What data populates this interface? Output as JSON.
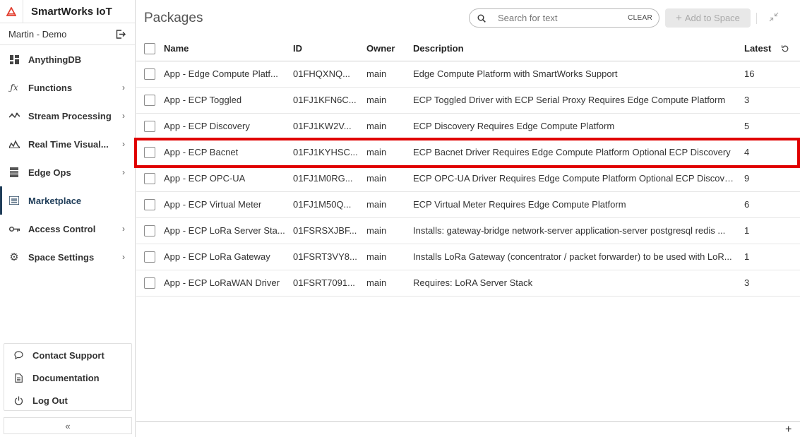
{
  "app": {
    "title": "SmartWorks IoT",
    "accent": "#e23c2d"
  },
  "user": {
    "name": "Martin - Demo"
  },
  "nav": [
    {
      "label": "AnythingDB",
      "icon": "dashboard-icon",
      "chevron": false,
      "active": false
    },
    {
      "label": "Functions",
      "icon": "function-icon",
      "chevron": true,
      "active": false
    },
    {
      "label": "Stream Processing",
      "icon": "stream-icon",
      "chevron": true,
      "active": false
    },
    {
      "label": "Real Time Visual...",
      "icon": "visualization-icon",
      "chevron": true,
      "active": false
    },
    {
      "label": "Edge Ops",
      "icon": "server-icon",
      "chevron": true,
      "active": false
    },
    {
      "label": "Marketplace",
      "icon": "list-icon",
      "chevron": false,
      "active": true
    },
    {
      "label": "Access Control",
      "icon": "key-icon",
      "chevron": true,
      "active": false
    },
    {
      "label": "Space Settings",
      "icon": "gear-icon",
      "chevron": true,
      "active": false
    }
  ],
  "bottom": {
    "contact": "Contact Support",
    "docs": "Documentation",
    "logout": "Log Out",
    "collapse": "«"
  },
  "main": {
    "title": "Packages",
    "search_placeholder": "Search for text",
    "clear_label": "CLEAR",
    "add_label": "Add to Space",
    "columns": {
      "name": "Name",
      "id": "ID",
      "owner": "Owner",
      "description": "Description",
      "latest": "Latest"
    },
    "rows": [
      {
        "name": "App - Edge Compute Platf...",
        "id": "01FHQXNQ...",
        "owner": "main",
        "description": "Edge Compute Platform with SmartWorks Support",
        "latest": "16"
      },
      {
        "name": "App - ECP Toggled",
        "id": "01FJ1KFN6C...",
        "owner": "main",
        "description": "ECP Toggled Driver with ECP Serial Proxy Requires Edge Compute Platform",
        "latest": "3"
      },
      {
        "name": "App - ECP Discovery",
        "id": "01FJ1KW2V...",
        "owner": "main",
        "description": "ECP Discovery Requires Edge Compute Platform",
        "latest": "5"
      },
      {
        "name": "App - ECP Bacnet",
        "id": "01FJ1KYHSC...",
        "owner": "main",
        "description": "ECP Bacnet Driver Requires Edge Compute Platform Optional ECP Discovery",
        "latest": "4"
      },
      {
        "name": "App - ECP OPC-UA",
        "id": "01FJ1M0RG...",
        "owner": "main",
        "description": "ECP OPC-UA Driver Requires Edge Compute Platform Optional ECP Discovery",
        "latest": "9"
      },
      {
        "name": "App - ECP Virtual Meter",
        "id": "01FJ1M50Q...",
        "owner": "main",
        "description": "ECP Virtual Meter Requires Edge Compute Platform",
        "latest": "6"
      },
      {
        "name": "App - ECP LoRa Server Sta...",
        "id": "01FSRSXJBF...",
        "owner": "main",
        "description": "Installs: gateway-bridge network-server application-server postgresql redis ...",
        "latest": "1"
      },
      {
        "name": "App - ECP LoRa Gateway",
        "id": "01FSRT3VY8...",
        "owner": "main",
        "description": "Installs LoRa Gateway (concentrator / packet forwarder) to be used with LoR...",
        "latest": "1"
      },
      {
        "name": "App - ECP LoRaWAN Driver",
        "id": "01FSRT7091...",
        "owner": "main",
        "description": "Requires: LoRA Server Stack",
        "latest": "3"
      }
    ],
    "highlight_color": "#e00000"
  },
  "footer": {
    "plus": "+"
  }
}
